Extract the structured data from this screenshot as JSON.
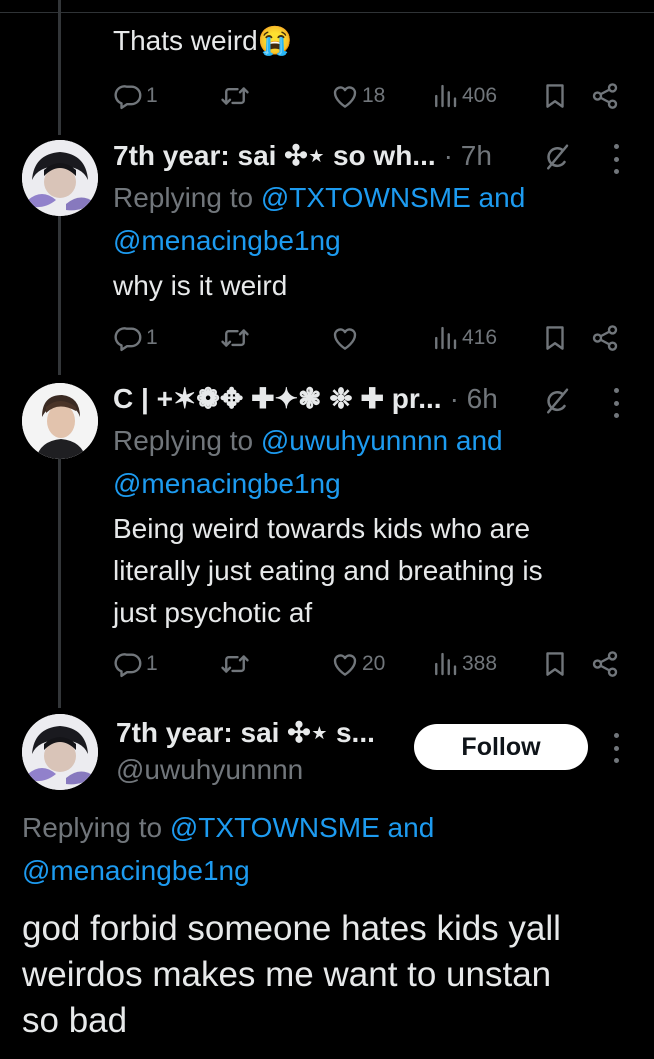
{
  "tweets": [
    {
      "text": "Thats weird",
      "emoji": "😭",
      "replies": "1",
      "retweets": "",
      "likes": "18",
      "views": "406"
    },
    {
      "name": "7th year: sai ✣⋆ so wh...",
      "time": "· 7h",
      "reply_prefix": "Replying to ",
      "reply_handle_1": "@TXTOWNSME",
      "reply_and": " and",
      "reply_handle_2": "@menacingbe1ng",
      "text": "why is it weird",
      "replies": "1",
      "retweets": "",
      "likes": "",
      "views": "416"
    },
    {
      "name": "C | +✶❁✥ ✚✦❃ ❉ ✚ pr...",
      "time": "· 6h",
      "reply_prefix": "Replying to ",
      "reply_handle_1": "@uwuhyunnnn",
      "reply_and": " and",
      "reply_handle_2": "@menacingbe1ng",
      "text_lines": [
        "Being weird towards kids who are",
        "literally just eating and breathing is",
        "just psychotic af"
      ],
      "replies": "1",
      "retweets": "",
      "likes": "20",
      "views": "388"
    }
  ],
  "main_tweet": {
    "name": "7th year: sai ✣⋆ s...",
    "handle": "@uwuhyunnnn",
    "follow_label": "Follow",
    "reply_prefix": "Replying to ",
    "reply_handle_1": "@TXTOWNSME",
    "reply_and": " and",
    "reply_handle_2": "@menacingbe1ng",
    "text_lines": [
      "god forbid someone hates kids yall",
      "weirdos makes me want to unstan",
      "so bad"
    ]
  },
  "icons": {
    "reply": "reply-icon",
    "retweet": "retweet-icon",
    "like": "heart-icon",
    "views": "views-icon",
    "bookmark": "bookmark-icon",
    "share": "share-icon",
    "grok": "grok-icon",
    "more": "more-icon"
  },
  "colors": {
    "background": "#000000",
    "text": "#e7e9ea",
    "muted": "#71767b",
    "link": "#1d9bf0",
    "follow_bg": "#ffffff"
  }
}
